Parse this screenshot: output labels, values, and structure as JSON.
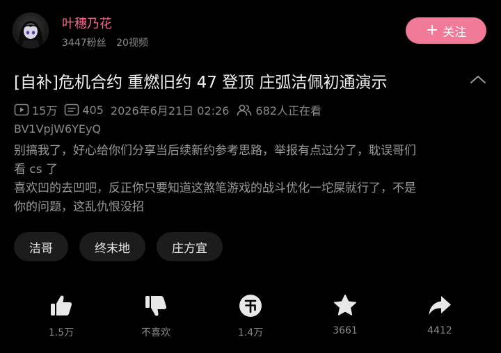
{
  "author": {
    "name": "叶穗乃花",
    "followers": "3447粉丝",
    "videos": "20视频",
    "follow_label": "关注",
    "follow_icon": "plus-icon"
  },
  "video": {
    "title": "[自补]危机合约 重燃旧约 47 登顶 庄弧洁佩初通演示",
    "views": "15万",
    "danmaku": "405",
    "date": "2026年6月21日 02:26",
    "watching": "682人正在看",
    "bvid": "BV1VpjW6YEyQ",
    "description": [
      "别搞我了，好心给你们分享当后续新约参考思路，举报有点过分了，耽误哥们",
      "看 cs 了",
      "喜欢凹的去凹吧，反正你只要知道这煞笔游戏的战斗优化一坨屎就行了，不是",
      "你的问题，这乱仇恨没招"
    ]
  },
  "tags": [
    "洁哥",
    "终末地",
    "庄方宜"
  ],
  "actions": {
    "like": "1.5万",
    "dislike": "不喜欢",
    "coin": "1.4万",
    "favorite": "3661",
    "share": "4412"
  },
  "colors": {
    "background": "#000000",
    "accent_pink": "#f07a98",
    "author_name": "#f26a8e",
    "secondary_text": "#8a8a8a",
    "icon_light": "#e8e8e8"
  }
}
